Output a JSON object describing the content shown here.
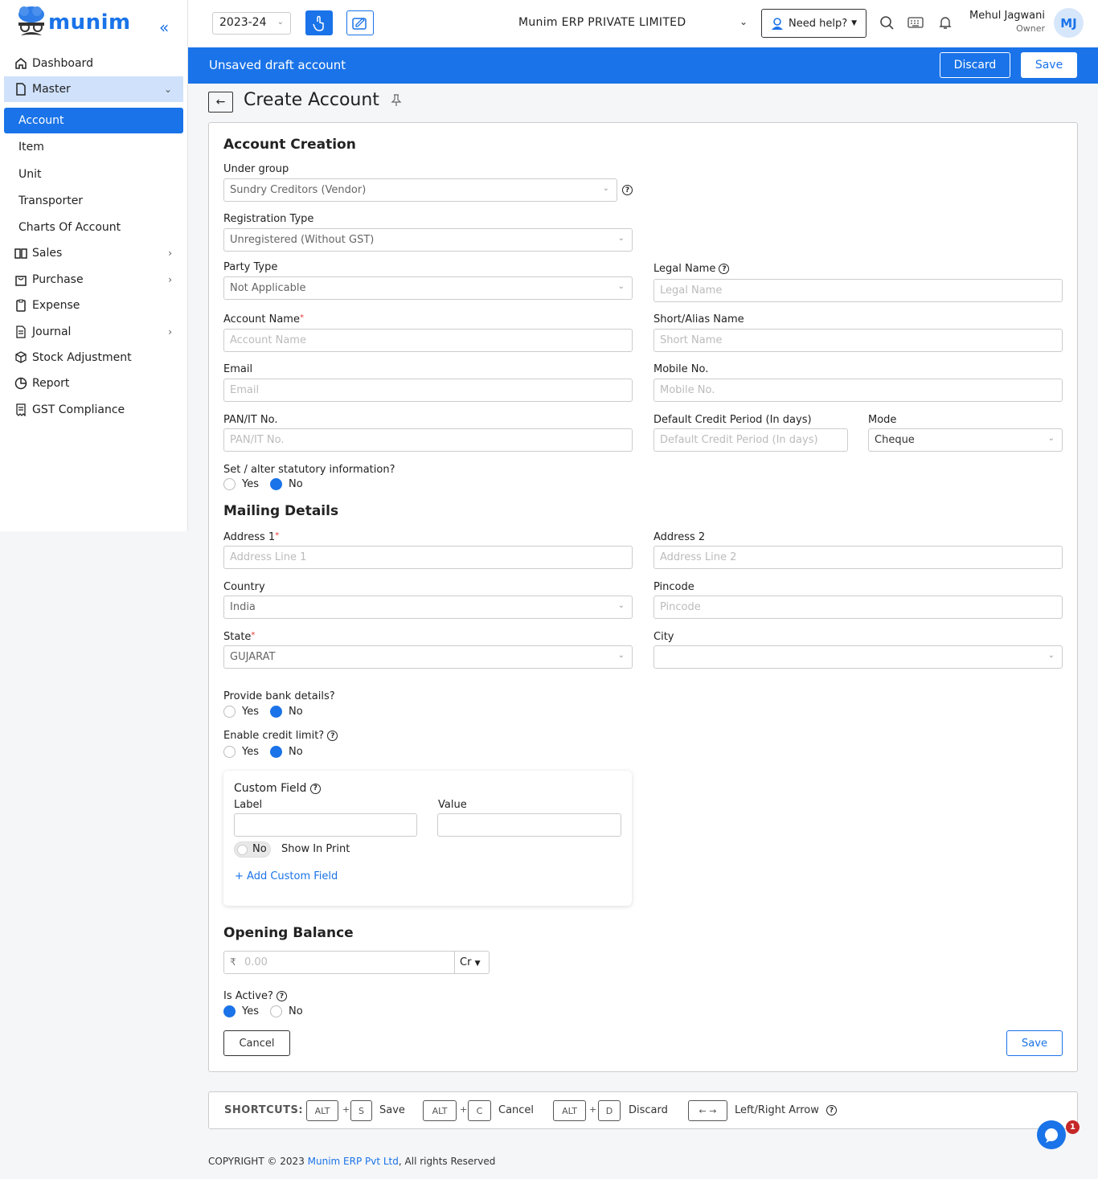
{
  "app": {
    "logo_text": "munim",
    "accent": "#1a73e8"
  },
  "sidebar": {
    "items": [
      {
        "label": "Dashboard",
        "icon": "home-icon"
      },
      {
        "label": "Master",
        "icon": "document-icon"
      },
      {
        "label": "Sales",
        "icon": "book-icon"
      },
      {
        "label": "Purchase",
        "icon": "bag-icon"
      },
      {
        "label": "Expense",
        "icon": "clipboard-icon"
      },
      {
        "label": "Journal",
        "icon": "journal-icon"
      },
      {
        "label": "Stock Adjustment",
        "icon": "stock-icon"
      },
      {
        "label": "Report",
        "icon": "pie-chart-icon"
      },
      {
        "label": "GST Compliance",
        "icon": "receipt-icon"
      }
    ],
    "sub_items": [
      "Account",
      "Item",
      "Unit",
      "Transporter",
      "Charts Of Account"
    ]
  },
  "topbar": {
    "financial_year": "2023-24",
    "company": "Munim ERP PRIVATE LIMITED",
    "help_label": "Need help?",
    "user_name": "Mehul Jagwani",
    "user_role": "Owner",
    "user_initials": "MJ"
  },
  "draftbar": {
    "text": "Unsaved draft account",
    "discard": "Discard",
    "save": "Save"
  },
  "page": {
    "title": "Create Account"
  },
  "form": {
    "section_creation": "Account Creation",
    "under_group": {
      "label": "Under group",
      "value": "Sundry Creditors (Vendor)"
    },
    "registration_type": {
      "label": "Registration Type",
      "value": "Unregistered (Without GST)"
    },
    "party_type": {
      "label": "Party Type",
      "value": "Not Applicable"
    },
    "legal_name": {
      "label": "Legal Name",
      "placeholder": "Legal Name"
    },
    "account_name": {
      "label": "Account Name",
      "placeholder": "Account Name"
    },
    "short_name": {
      "label": "Short/Alias Name",
      "placeholder": "Short Name"
    },
    "email": {
      "label": "Email",
      "placeholder": "Email"
    },
    "mobile": {
      "label": "Mobile No.",
      "placeholder": "Mobile No."
    },
    "pan": {
      "label": "PAN/IT No.",
      "placeholder": "PAN/IT No."
    },
    "credit_period": {
      "label": "Default Credit Period (In days)",
      "placeholder": "Default Credit Period (In days)"
    },
    "mode": {
      "label": "Mode",
      "value": "Cheque"
    },
    "statutory": {
      "label": "Set / alter statutory information?",
      "yes": "Yes",
      "no": "No",
      "selected": "No"
    },
    "section_mailing": "Mailing Details",
    "address1": {
      "label": "Address 1",
      "placeholder": "Address Line 1"
    },
    "address2": {
      "label": "Address 2",
      "placeholder": "Address Line 2"
    },
    "country": {
      "label": "Country",
      "value": "India"
    },
    "pincode": {
      "label": "Pincode",
      "placeholder": "Pincode"
    },
    "state": {
      "label": "State",
      "value": "GUJARAT"
    },
    "city": {
      "label": "City",
      "value": ""
    },
    "bank": {
      "label": "Provide bank details?",
      "yes": "Yes",
      "no": "No",
      "selected": "No"
    },
    "credit_limit": {
      "label": "Enable credit limit?",
      "yes": "Yes",
      "no": "No",
      "selected": "No"
    },
    "custom_field": {
      "title": "Custom Field",
      "label_col": "Label",
      "value_col": "Value",
      "toggle": "No",
      "show_in_print": "Show In Print",
      "add": "+ Add Custom Field"
    },
    "section_opening": "Opening Balance",
    "opening": {
      "currency": "₹",
      "placeholder": "0.00",
      "type": "Cr"
    },
    "is_active": {
      "label": "Is Active?",
      "yes": "Yes",
      "no": "No",
      "selected": "Yes"
    },
    "cancel": "Cancel",
    "save": "Save"
  },
  "shortcuts": {
    "title": "SHORTCUTS:",
    "items": [
      {
        "mod": "ALT",
        "key": "S",
        "label": "Save"
      },
      {
        "mod": "ALT",
        "key": "C",
        "label": "Cancel"
      },
      {
        "mod": "ALT",
        "key": "D",
        "label": "Discard"
      }
    ],
    "arrow_keys": "← →",
    "arrow_label": "Left/Right Arrow"
  },
  "chat": {
    "badge": "1"
  },
  "footer": {
    "prefix": "COPYRIGHT © 2023 ",
    "link": "Munim ERP Pvt Ltd",
    "suffix": ", All rights Reserved"
  }
}
